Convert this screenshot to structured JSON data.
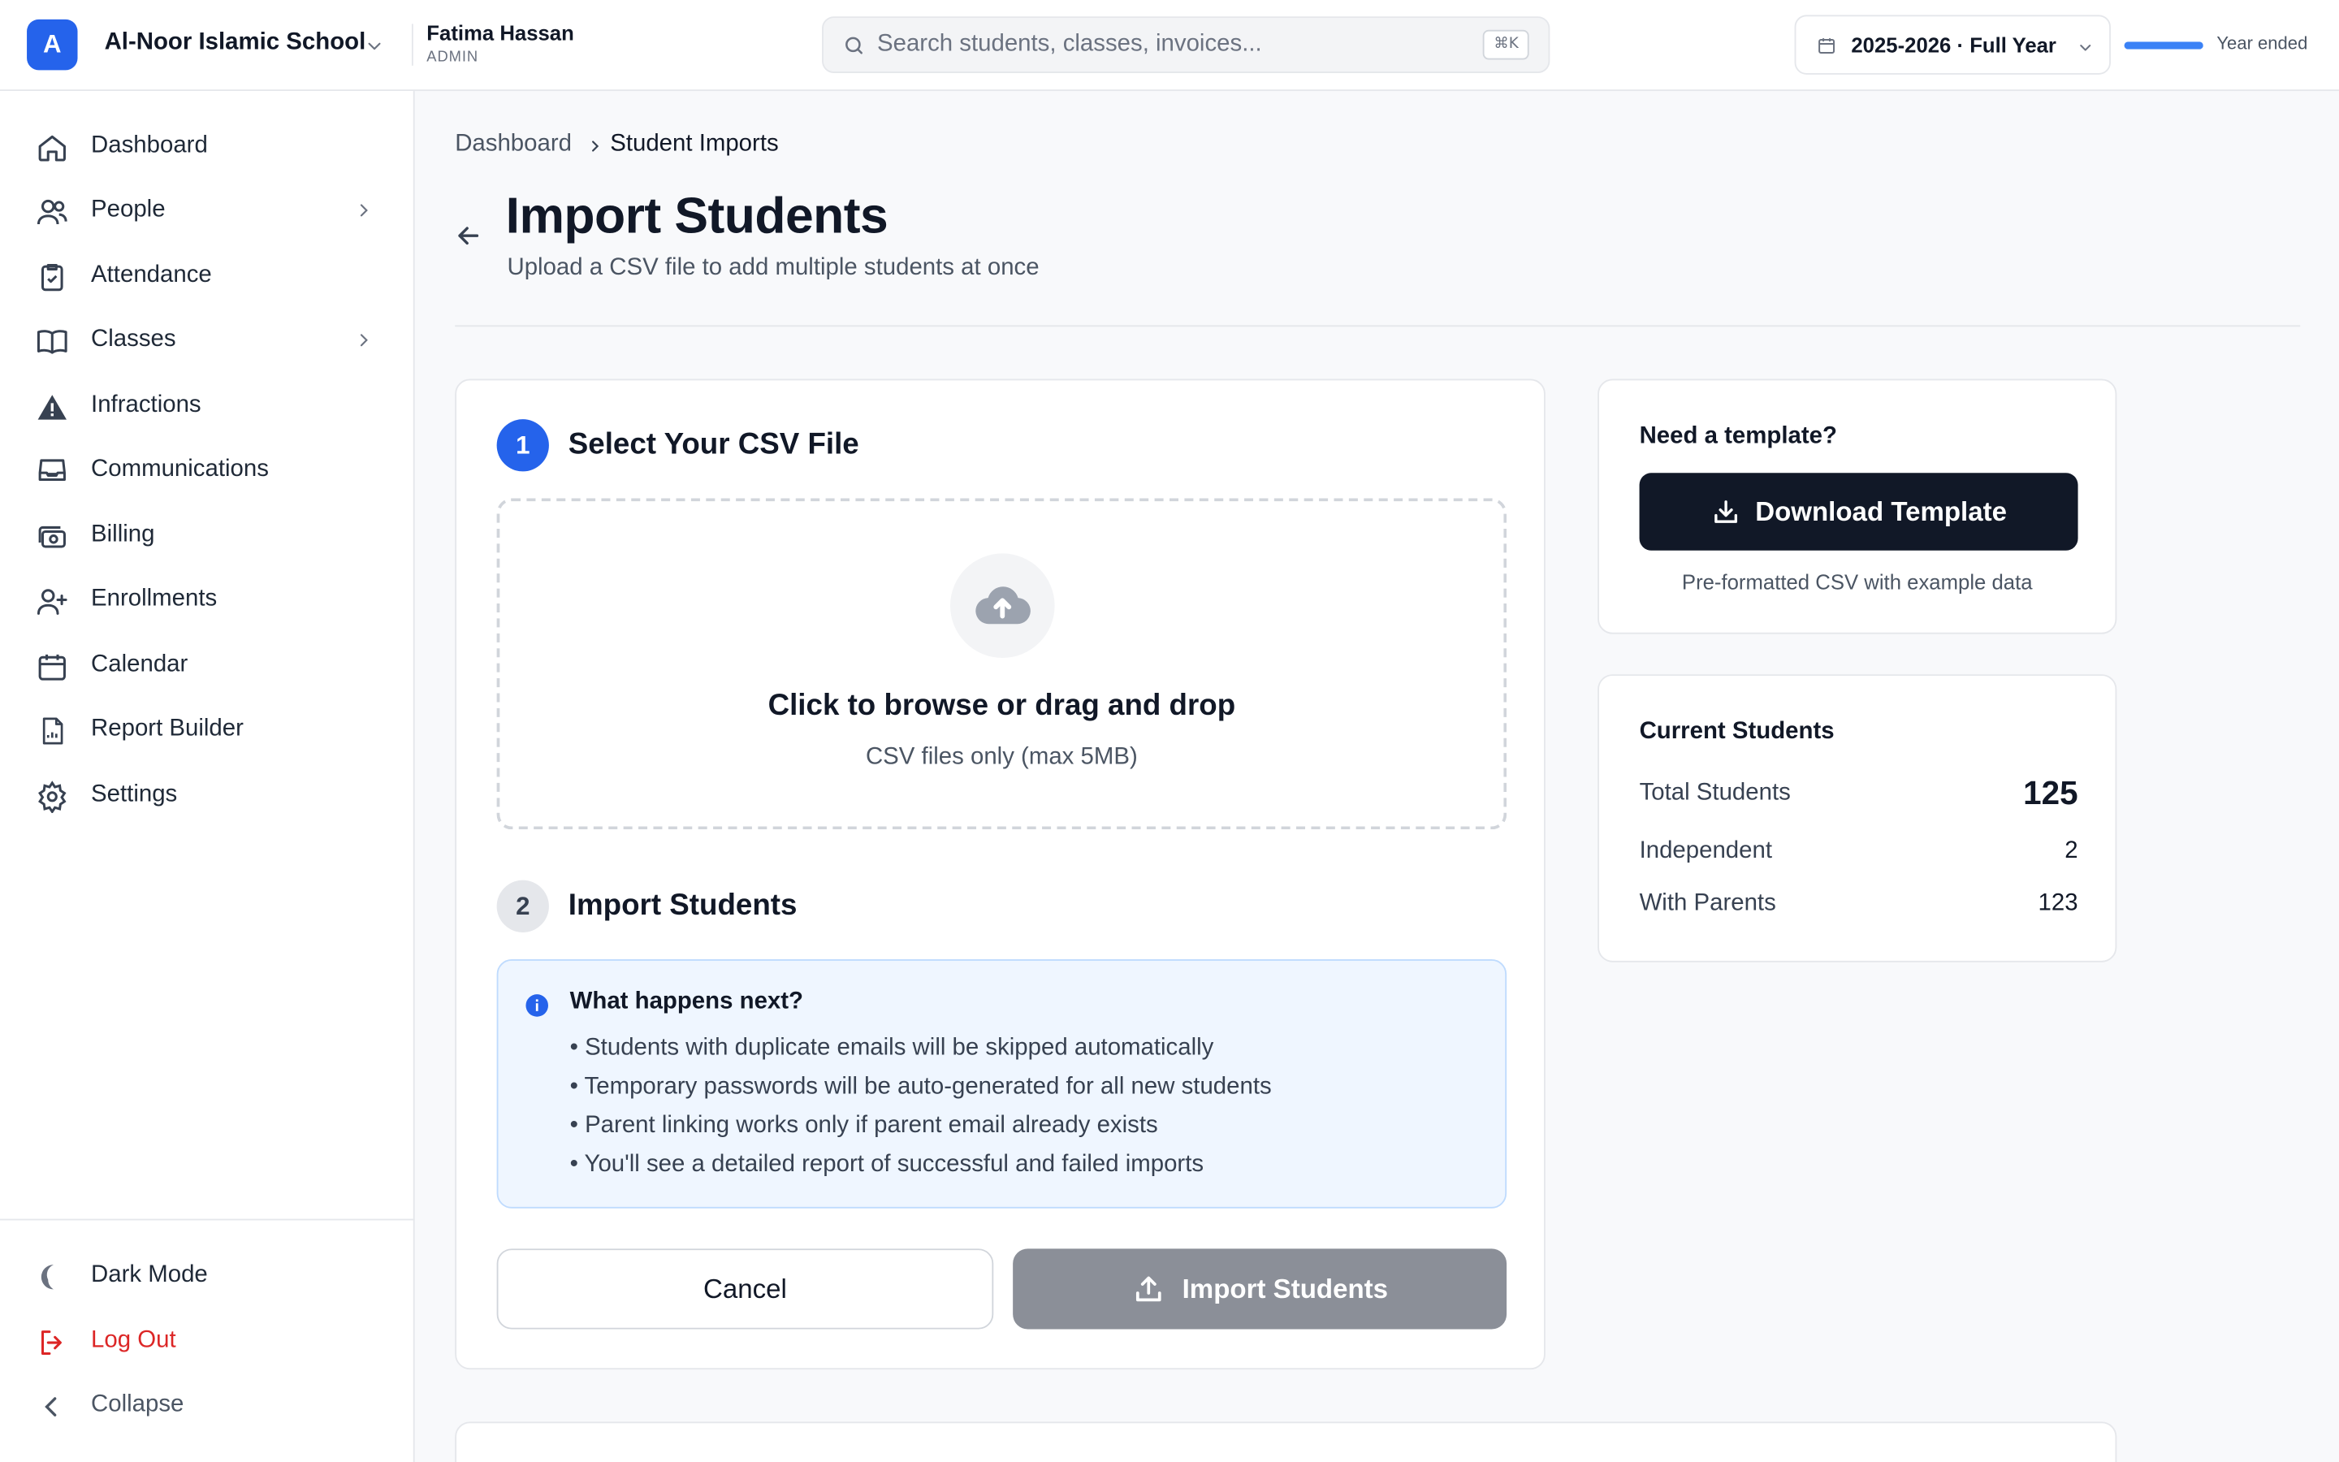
{
  "header": {
    "logo_letter": "A",
    "school_name": "Al-Noor Islamic School",
    "user_name": "Fatima Hassan",
    "user_role": "ADMIN",
    "search_placeholder": "Search students, classes, invoices...",
    "search_shortcut": "⌘K",
    "year_label": "2025-2026 · Full Year",
    "year_progress": 1.0,
    "year_status": "Year ended"
  },
  "sidebar": {
    "items": [
      {
        "label": "Dashboard",
        "icon": "home-icon"
      },
      {
        "label": "People",
        "icon": "users-icon",
        "expandable": true
      },
      {
        "label": "Attendance",
        "icon": "clipboard-check-icon"
      },
      {
        "label": "Classes",
        "icon": "book-icon",
        "expandable": true
      },
      {
        "label": "Infractions",
        "icon": "warning-icon"
      },
      {
        "label": "Communications",
        "icon": "inbox-icon"
      },
      {
        "label": "Billing",
        "icon": "billing-icon"
      },
      {
        "label": "Enrollments",
        "icon": "user-plus-icon"
      },
      {
        "label": "Calendar",
        "icon": "calendar-icon"
      },
      {
        "label": "Report Builder",
        "icon": "report-icon"
      },
      {
        "label": "Settings",
        "icon": "gear-icon"
      }
    ],
    "footer": {
      "dark_mode": "Dark Mode",
      "logout": "Log Out",
      "collapse": "Collapse"
    }
  },
  "breadcrumb": {
    "root": "Dashboard",
    "current": "Student Imports"
  },
  "page": {
    "title": "Import Students",
    "subtitle": "Upload a CSV file to add multiple students at once"
  },
  "steps": {
    "step1": {
      "number": "1",
      "title": "Select Your CSV File"
    },
    "dropzone": {
      "title": "Click to browse or drag and drop",
      "subtitle": "CSV files only (max 5MB)"
    },
    "step2": {
      "number": "2",
      "title": "Import Students"
    },
    "info": {
      "title": "What happens next?",
      "items": [
        "• Students with duplicate emails will be skipped automatically",
        "• Temporary passwords will be auto-generated for all new students",
        "• Parent linking works only if parent email already exists",
        "• You'll see a detailed report of successful and failed imports"
      ]
    },
    "cancel_label": "Cancel",
    "import_label": "Import Students"
  },
  "template": {
    "title": "Need a template?",
    "button_label": "Download Template",
    "note": "Pre-formatted CSV with example data"
  },
  "stats": {
    "title": "Current Students",
    "rows": [
      {
        "label": "Total Students",
        "value": "125"
      },
      {
        "label": "Independent",
        "value": "2"
      },
      {
        "label": "With Parents",
        "value": "123"
      }
    ]
  },
  "colors": {
    "accent": "#2563eb",
    "danger": "#dc2626",
    "dark_button": "#111827",
    "disabled_button": "#8b8f98"
  }
}
